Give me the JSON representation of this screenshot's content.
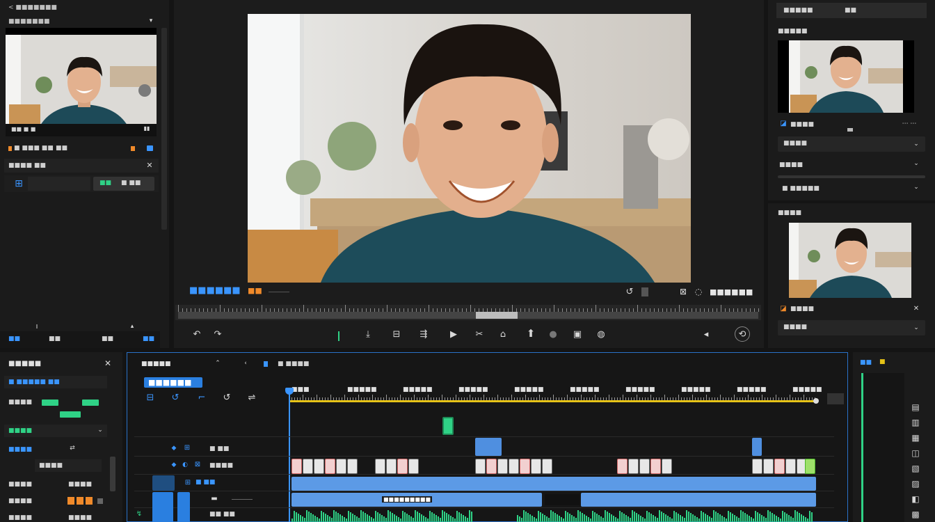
{
  "colors": {
    "accent_blue": "#3a95ff",
    "clip_blue": "#4f8fe0",
    "audio_green": "#2fd286",
    "orange": "#f08a2a",
    "playhead_yellow": "#e6c317"
  },
  "left_panel": {
    "source_header": "<  ■■■■■■■",
    "source_subheader": "■■■■■■■",
    "timecode_overlay": "■■ ■ ■",
    "row1_label": "■ ■■■ ■■",
    "row1_label2": "■■",
    "row2_label": "■■■■ ■■",
    "row3_btn_a": "■■",
    "row3_btn_b": "■ ■■",
    "footer_a": "■■",
    "footer_b": "■■",
    "footer_c": "■■",
    "footer_d": "■■"
  },
  "viewer": {
    "clip_title": "■■■■■■",
    "clip_sub": "■■",
    "timecode": "■■■■■■",
    "icons": [
      "undo-icon",
      "redo-icon",
      "marker-icon",
      "in-point-icon",
      "out-point-icon",
      "play-icon",
      "cut-icon",
      "export-icon",
      "record-icon",
      "settings-icon"
    ]
  },
  "right_panel": {
    "top_label": "■■■■■",
    "top_label2": "■■",
    "preview_title": "■■■■■",
    "preview_label": "■■■■",
    "dropdown1": "■■■■",
    "dropdown2": "■■■■",
    "row3_label": "■ ■■■■■",
    "section2_title": "■■■■",
    "preview2_label": "■■■■",
    "dropdown3": "■■■■"
  },
  "inspector": {
    "title": "■■■■■",
    "subtitle": "■ ■■■■■ ■■",
    "row1_label": "■■■■",
    "row2_label": "■■■■",
    "row3_label": "■■■■",
    "row3_value": "■■■■",
    "row4_label": "■■■■",
    "row4_value": "■■■■",
    "row5_label": "■■■■",
    "row5_value": "■■■■",
    "row6_label": "■■■■",
    "row6_value": "■■■■"
  },
  "timeline": {
    "tab_title": "■■■■■",
    "tab_sub": "■ ■■■■",
    "timecode_display": "■■■■■■",
    "ruler_labels": [
      "■■■",
      "■■■■■",
      "■■■■■",
      "■■■■■",
      "■■■■■",
      "■■■■■",
      "■■■■■",
      "■■■■■",
      "■■■■■",
      "■■■■■"
    ],
    "track_labels": [
      "■ ■■",
      "■■■■",
      "■ ■■",
      "■■ ■■"
    ],
    "clip_label_a": "■■■■■■■■■"
  },
  "far_right": {
    "header": "■■",
    "header_badge": "■"
  }
}
